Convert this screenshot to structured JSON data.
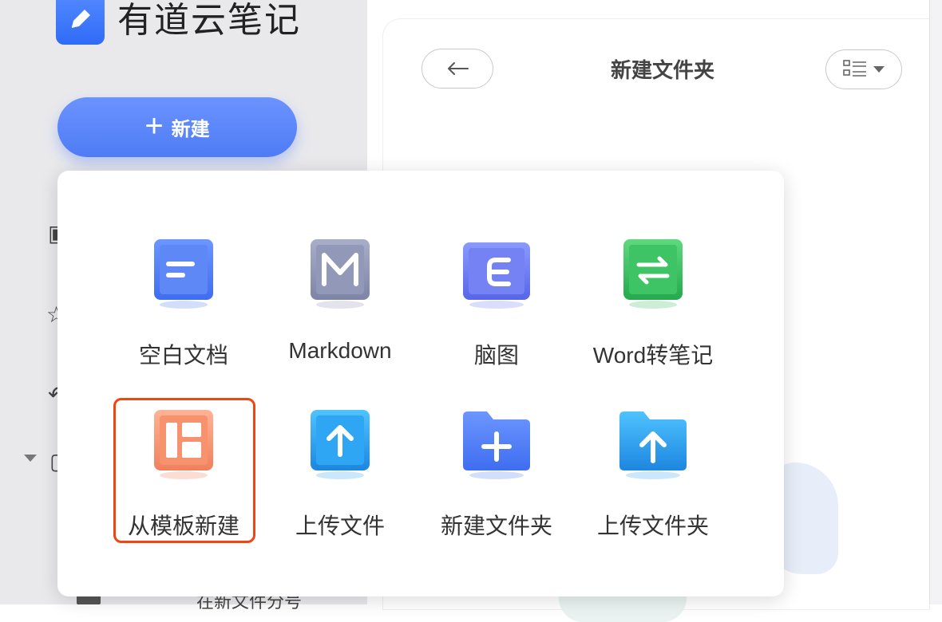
{
  "app": {
    "title": "有道云笔记",
    "logo_icon": "pen-icon"
  },
  "sidebar": {
    "new_button": {
      "icon": "plus-icon",
      "label": "新建"
    },
    "bottom_row_text": "在新文件分号"
  },
  "main": {
    "title": "新建文件夹",
    "back_icon": "arrow-left-icon",
    "view_icon": "list-view-icon"
  },
  "menu": {
    "items": [
      {
        "label": "空白文档",
        "icon": "blank-doc-icon",
        "color": "#4f7cf5"
      },
      {
        "label": "Markdown",
        "icon": "markdown-icon",
        "color": "#8a90b0"
      },
      {
        "label": "脑图",
        "icon": "mindmap-icon",
        "color": "#6b78ef"
      },
      {
        "label": "Word转笔记",
        "icon": "word-convert-icon",
        "color": "#34b85a"
      },
      {
        "label": "从模板新建",
        "icon": "template-icon",
        "color": "#f59070",
        "highlighted": true
      },
      {
        "label": "上传文件",
        "icon": "upload-file-icon",
        "color": "#2c9ef0"
      },
      {
        "label": "新建文件夹",
        "icon": "new-folder-icon",
        "color": "#4f7cf5"
      },
      {
        "label": "上传文件夹",
        "icon": "upload-folder-icon",
        "color": "#2c9ef0"
      }
    ]
  },
  "colors": {
    "accent": "#4f7cf5",
    "highlight": "#ee4512"
  }
}
